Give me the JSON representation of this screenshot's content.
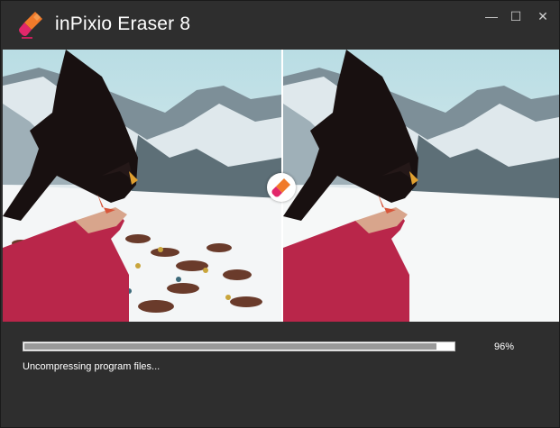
{
  "window": {
    "title": "inPixio Eraser 8",
    "controls": {
      "minimize": "—",
      "maximize": "☐",
      "close": "✕"
    }
  },
  "preview": {
    "before_image": "photo-raven-on-arm-with-crowd",
    "after_image": "photo-raven-on-arm-crowd-erased",
    "compare_icon": "eraser-icon"
  },
  "install": {
    "progress": 0.96,
    "percent_label": "96%",
    "status_text": "Uncompressing program files..."
  },
  "colors": {
    "background": "#2e2e2e",
    "progress_fill": "#9a9a9a",
    "progress_track": "#ffffff",
    "logo_orange": "#f07a2a",
    "logo_pink": "#e2276a"
  }
}
